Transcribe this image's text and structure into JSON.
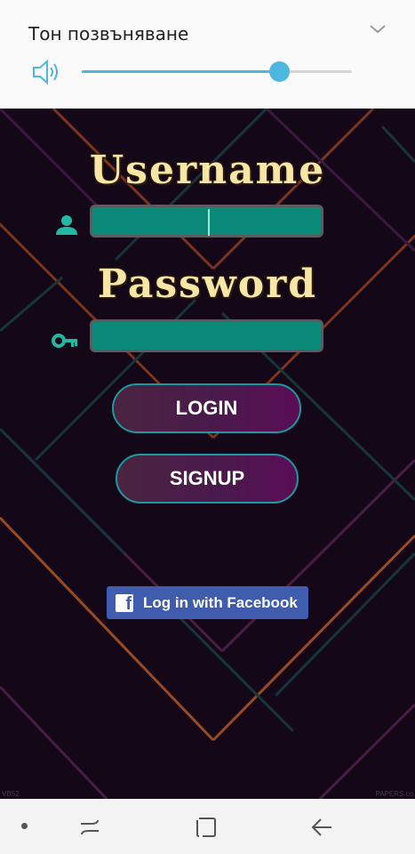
{
  "volume": {
    "title": "Тон позвъняване",
    "level_percent": 73,
    "accent_color": "#4cb8e0"
  },
  "login": {
    "username_label": "Username",
    "password_label": "Password",
    "username_value": "",
    "password_value": "",
    "login_button": "LOGIN",
    "signup_button": "SIGNUP",
    "facebook_button": "Log in with Facebook"
  },
  "watermark": {
    "left": "VB52",
    "right": "PAPERS.co"
  },
  "icons": {
    "chevron": "chevron-down-icon",
    "speaker": "speaker-icon",
    "user": "user-icon",
    "key": "key-icon",
    "facebook": "facebook-icon",
    "recent": "recent-apps-icon",
    "home": "home-icon",
    "back": "back-icon"
  }
}
